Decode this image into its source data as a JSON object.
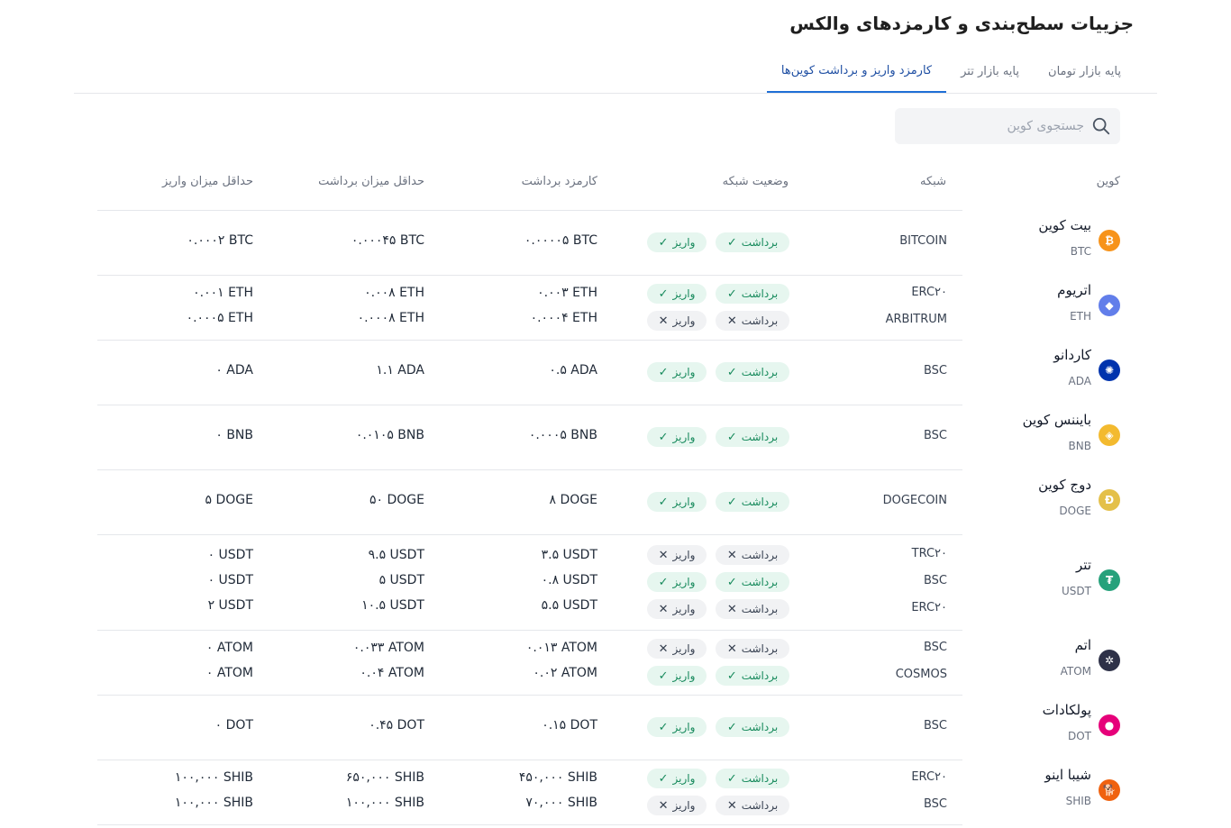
{
  "page_title": "جزییات سطح‌بندی و کارمزدهای والکس",
  "tabs": [
    {
      "label": "پایه بازار تومان",
      "active": false
    },
    {
      "label": "پایه بازار تتر",
      "active": false
    },
    {
      "label": "کارمزد واریز و برداشت کوین‌ها",
      "active": true
    }
  ],
  "search": {
    "placeholder": "جستجوی کوین"
  },
  "columns": {
    "coin": "کوین",
    "network": "شبکه",
    "status": "وضعیت شبکه",
    "withdraw_fee": "کارمزد برداشت",
    "min_withdraw": "حداقل میزان برداشت",
    "min_deposit": "حداقل میزان واریز"
  },
  "status_labels": {
    "withdraw": "برداشت",
    "deposit": "واریز"
  },
  "status_colors": {
    "enabled_bg": "#e6f6ef",
    "enabled_text": "#178a5c",
    "disabled_bg": "#f1f2f4"
  },
  "coins": [
    {
      "name": "بیت کوین",
      "symbol": "BTC",
      "icon": "bitcoin-icon",
      "color": "#f7931a",
      "networks": [
        {
          "network": "BITCOIN",
          "withdraw_enabled": true,
          "deposit_enabled": true,
          "withdraw_fee": "۰.۰۰۰۰۵ BTC",
          "min_withdraw": "۰.۰۰۰۴۵ BTC",
          "min_deposit": "۰.۰۰۰۲ BTC"
        }
      ]
    },
    {
      "name": "اتریوم",
      "symbol": "ETH",
      "icon": "ethereum-icon",
      "color": "#627eea",
      "networks": [
        {
          "network": "ERC۲۰",
          "withdraw_enabled": true,
          "deposit_enabled": true,
          "withdraw_fee": "۰.۰۰۳ ETH",
          "min_withdraw": "۰.۰۰۸ ETH",
          "min_deposit": "۰.۰۰۱ ETH"
        },
        {
          "network": "ARBITRUM",
          "withdraw_enabled": false,
          "deposit_enabled": false,
          "withdraw_fee": "۰.۰۰۰۴ ETH",
          "min_withdraw": "۰.۰۰۰۸ ETH",
          "min_deposit": "۰.۰۰۰۵ ETH"
        }
      ]
    },
    {
      "name": "کاردانو",
      "symbol": "ADA",
      "icon": "cardano-icon",
      "color": "#0033ad",
      "networks": [
        {
          "network": "BSC",
          "withdraw_enabled": true,
          "deposit_enabled": true,
          "withdraw_fee": "۰.۵ ADA",
          "min_withdraw": "۱.۱ ADA",
          "min_deposit": "۰ ADA"
        }
      ]
    },
    {
      "name": "بایننس کوین",
      "symbol": "BNB",
      "icon": "binance-icon",
      "color": "#f3ba2f",
      "networks": [
        {
          "network": "BSC",
          "withdraw_enabled": true,
          "deposit_enabled": true,
          "withdraw_fee": "۰.۰۰۰۵ BNB",
          "min_withdraw": "۰.۰۱۰۵ BNB",
          "min_deposit": "۰ BNB"
        }
      ]
    },
    {
      "name": "دوج کوین",
      "symbol": "DOGE",
      "icon": "dogecoin-icon",
      "color": "#e4c04a",
      "networks": [
        {
          "network": "DOGECOIN",
          "withdraw_enabled": true,
          "deposit_enabled": true,
          "withdraw_fee": "۸ DOGE",
          "min_withdraw": "۵۰ DOGE",
          "min_deposit": "۵ DOGE"
        }
      ]
    },
    {
      "name": "تتر",
      "symbol": "USDT",
      "icon": "tether-icon",
      "color": "#26a17b",
      "networks": [
        {
          "network": "TRC۲۰",
          "withdraw_enabled": false,
          "deposit_enabled": false,
          "withdraw_fee": "۳.۵ USDT",
          "min_withdraw": "۹.۵ USDT",
          "min_deposit": "۰ USDT"
        },
        {
          "network": "BSC",
          "withdraw_enabled": true,
          "deposit_enabled": true,
          "withdraw_fee": "۰.۸ USDT",
          "min_withdraw": "۵ USDT",
          "min_deposit": "۰ USDT"
        },
        {
          "network": "ERC۲۰",
          "withdraw_enabled": false,
          "deposit_enabled": false,
          "withdraw_fee": "۵.۵ USDT",
          "min_withdraw": "۱۰.۵ USDT",
          "min_deposit": "۲ USDT"
        }
      ]
    },
    {
      "name": "اتم",
      "symbol": "ATOM",
      "icon": "cosmos-icon",
      "color": "#2e3148",
      "networks": [
        {
          "network": "BSC",
          "withdraw_enabled": false,
          "deposit_enabled": false,
          "withdraw_fee": "۰.۰۱۳ ATOM",
          "min_withdraw": "۰.۰۳۳ ATOM",
          "min_deposit": "۰ ATOM"
        },
        {
          "network": "COSMOS",
          "withdraw_enabled": true,
          "deposit_enabled": true,
          "withdraw_fee": "۰.۰۲ ATOM",
          "min_withdraw": "۰.۰۴ ATOM",
          "min_deposit": "۰ ATOM"
        }
      ]
    },
    {
      "name": "پولکادات",
      "symbol": "DOT",
      "icon": "polkadot-icon",
      "color": "#e6007a",
      "networks": [
        {
          "network": "BSC",
          "withdraw_enabled": true,
          "deposit_enabled": true,
          "withdraw_fee": "۰.۱۵ DOT",
          "min_withdraw": "۰.۴۵ DOT",
          "min_deposit": "۰ DOT"
        }
      ]
    },
    {
      "name": "شیبا اینو",
      "symbol": "SHIB",
      "icon": "shiba-inu-icon",
      "color": "#f0620f",
      "networks": [
        {
          "network": "ERC۲۰",
          "withdraw_enabled": true,
          "deposit_enabled": true,
          "withdraw_fee": "۴۵۰,۰۰۰ SHIB",
          "min_withdraw": "۶۵۰,۰۰۰ SHIB",
          "min_deposit": "۱۰۰,۰۰۰ SHIB"
        },
        {
          "network": "BSC",
          "withdraw_enabled": false,
          "deposit_enabled": false,
          "withdraw_fee": "۷۰,۰۰۰ SHIB",
          "min_withdraw": "۱۰۰,۰۰۰ SHIB",
          "min_deposit": "۱۰۰,۰۰۰ SHIB"
        }
      ]
    }
  ]
}
